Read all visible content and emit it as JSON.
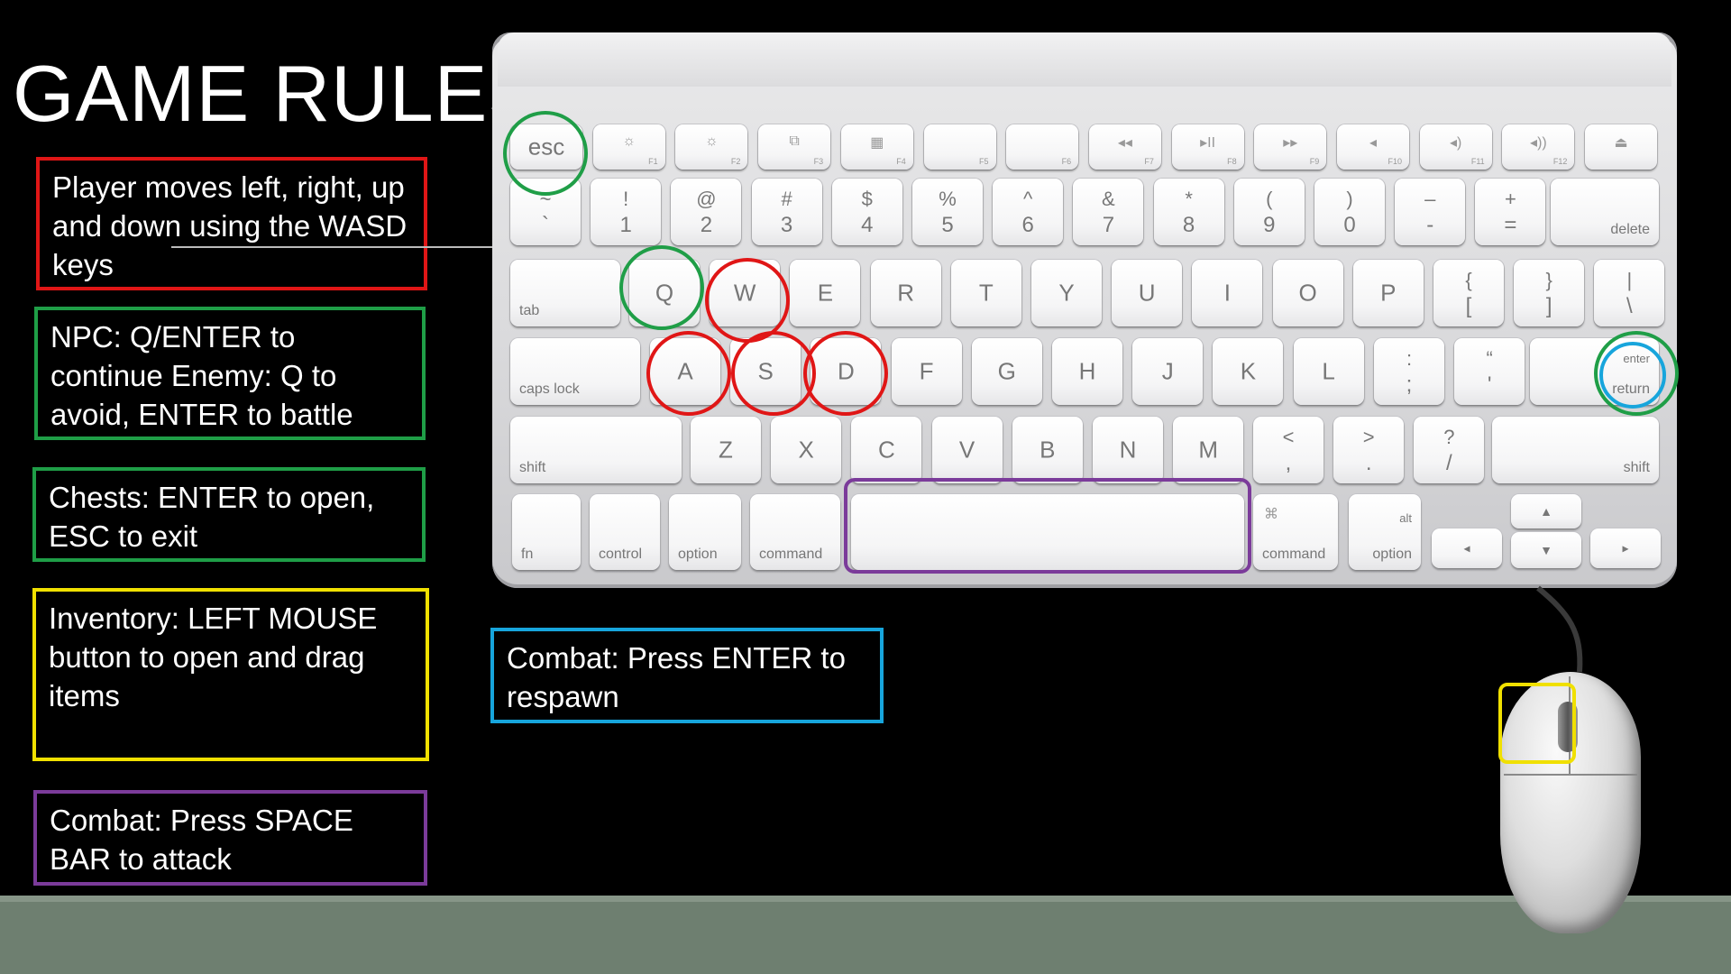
{
  "title": "GAME RULES",
  "colors": {
    "red": "#e01616",
    "green": "#1f9e47",
    "yellow": "#f0e000",
    "purple": "#7b3b9a",
    "blue": "#17a5dc"
  },
  "rules": [
    {
      "id": "movement",
      "color": "red",
      "text": "Player moves left, right, up and down using the WASD keys"
    },
    {
      "id": "npc",
      "color": "green",
      "text": "NPC: Q/ENTER to continue Enemy: Q to avoid, ENTER to battle"
    },
    {
      "id": "chests",
      "color": "green",
      "text": "Chests: ENTER to open, ESC to exit"
    },
    {
      "id": "inventory",
      "color": "yellow",
      "text": "Inventory: LEFT MOUSE button to open and drag items"
    },
    {
      "id": "combat-attack",
      "color": "purple",
      "text": "Combat: Press SPACE BAR to attack"
    },
    {
      "id": "combat-respawn",
      "color": "blue",
      "text": "Combat: Press ENTER to respawn"
    }
  ],
  "keyboard": {
    "fn_row": [
      "esc",
      "F1",
      "F2",
      "F3",
      "F4",
      "F5",
      "F6",
      "F7",
      "F8",
      "F9",
      "F10",
      "F11",
      "F12",
      ""
    ],
    "fn_icons": [
      "",
      "☼",
      "☼",
      "⧉",
      "▦",
      "",
      "",
      "◂◂",
      "▸II",
      "▸▸",
      "◂",
      "◂)",
      "◂))",
      "⏏"
    ],
    "number_row": [
      [
        "~",
        "`"
      ],
      [
        "!",
        "1"
      ],
      [
        "@",
        "2"
      ],
      [
        "#",
        "3"
      ],
      [
        "$",
        "4"
      ],
      [
        "%",
        "5"
      ],
      [
        "^",
        "6"
      ],
      [
        "&",
        "7"
      ],
      [
        "*",
        "8"
      ],
      [
        "(",
        "9"
      ],
      [
        ")",
        "0"
      ],
      [
        "–",
        "-"
      ],
      [
        "+",
        "="
      ]
    ],
    "delete": "delete",
    "tab": "tab",
    "qwerty": [
      "Q",
      "W",
      "E",
      "R",
      "T",
      "Y",
      "U",
      "I",
      "O",
      "P"
    ],
    "brackets": [
      [
        "{",
        "["
      ],
      [
        "}",
        "]"
      ],
      [
        "|",
        "\\"
      ]
    ],
    "caps": "caps lock",
    "asdf": [
      "A",
      "S",
      "D",
      "F",
      "G",
      "H",
      "J",
      "K",
      "L"
    ],
    "semi": [
      [
        ":",
        ";"
      ],
      [
        "“",
        "'"
      ]
    ],
    "enter_top": "enter",
    "enter_bot": "return",
    "shift": "shift",
    "zxcv": [
      "Z",
      "X",
      "C",
      "V",
      "B",
      "N",
      "M"
    ],
    "punct": [
      [
        "<",
        ","
      ],
      [
        ">",
        "."
      ],
      [
        "?",
        "/"
      ]
    ],
    "bottom": {
      "fn": "fn",
      "control": "control",
      "option": "option",
      "command": "command",
      "cmd_symbol": "⌘",
      "alt": "alt"
    },
    "arrows": {
      "up": "▲",
      "down": "▼",
      "left": "◂",
      "right": "▸"
    }
  }
}
